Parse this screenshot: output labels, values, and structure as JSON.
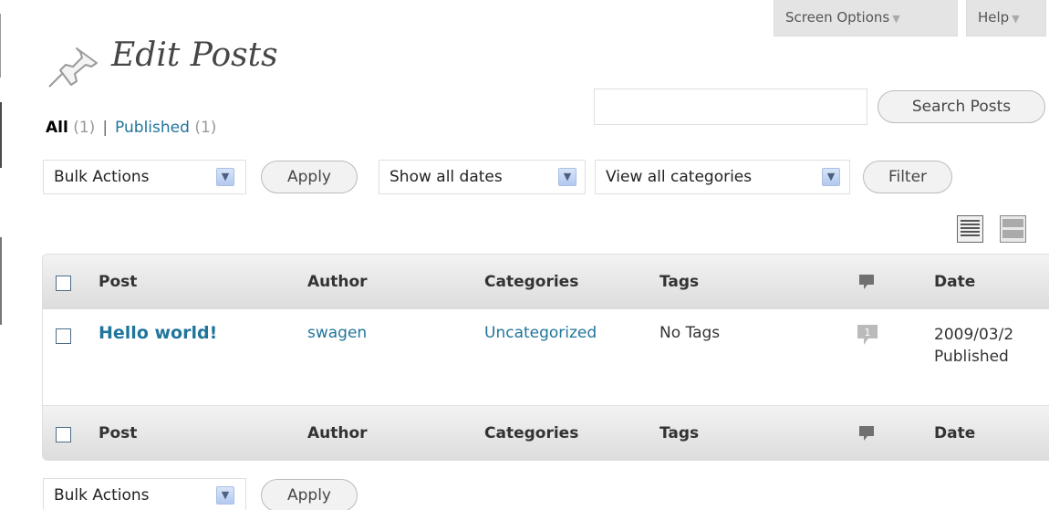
{
  "header": {
    "screen_options_label": "Screen Options",
    "help_label": "Help",
    "title": "Edit Posts",
    "icon": "pushpin-icon"
  },
  "search": {
    "value": "",
    "button_label": "Search Posts"
  },
  "filters": {
    "all_label": "All",
    "all_count": "(1)",
    "separator": "|",
    "published_label": "Published",
    "published_count": "(1)"
  },
  "toolbar": {
    "bulk_actions": "Bulk Actions",
    "apply_label": "Apply",
    "dates_select": "Show all dates",
    "categories_select": "View all categories",
    "filter_label": "Filter"
  },
  "table": {
    "columns": [
      "Post",
      "Author",
      "Categories",
      "Tags",
      "Date"
    ],
    "comments_icon": "comment-bubble-icon",
    "rows": [
      {
        "post": "Hello world!",
        "author": "swagen",
        "categories": "Uncategorized",
        "tags": "No Tags",
        "comments": "1",
        "date": "2009/03/2",
        "status": "Published"
      }
    ]
  },
  "colors": {
    "link": "#21759b",
    "header_bg": "#e4e4e4"
  }
}
